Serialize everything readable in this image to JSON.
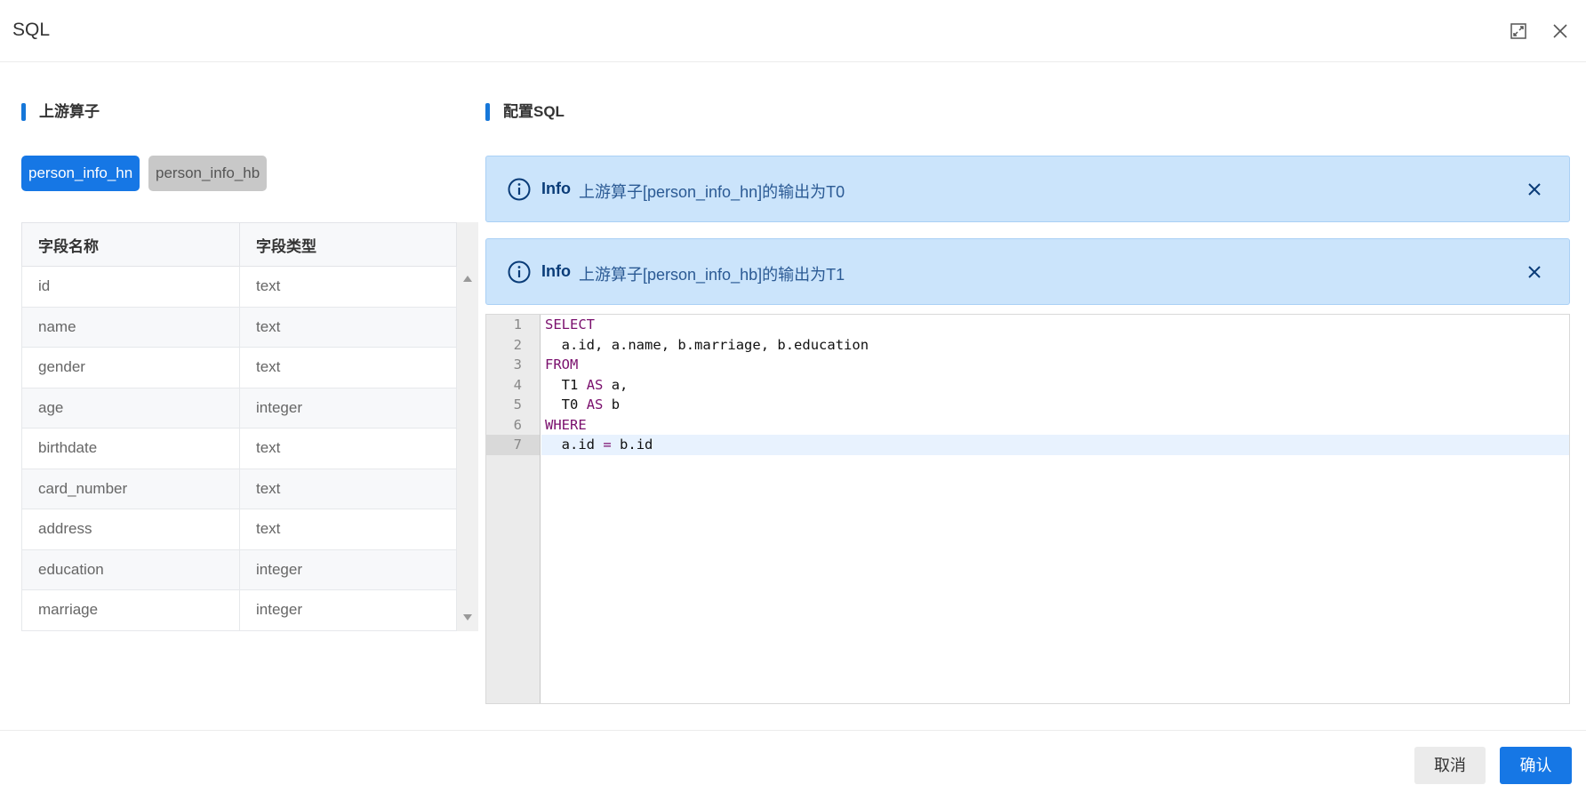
{
  "dialog": {
    "title": "SQL"
  },
  "left": {
    "section_title": "上游算子",
    "tabs": [
      {
        "label": "person_info_hn",
        "active": true
      },
      {
        "label": "person_info_hb",
        "active": false
      }
    ],
    "table": {
      "headers": [
        "字段名称",
        "字段类型"
      ],
      "rows": [
        [
          "id",
          "text"
        ],
        [
          "name",
          "text"
        ],
        [
          "gender",
          "text"
        ],
        [
          "age",
          "integer"
        ],
        [
          "birthdate",
          "text"
        ],
        [
          "card_number",
          "text"
        ],
        [
          "address",
          "text"
        ],
        [
          "education",
          "integer"
        ],
        [
          "marriage",
          "integer"
        ]
      ]
    }
  },
  "right": {
    "section_title": "配置SQL",
    "alerts": [
      {
        "label": "Info",
        "text": "上游算子[person_info_hn]的输出为T0"
      },
      {
        "label": "Info",
        "text": "上游算子[person_info_hb]的输出为T1"
      }
    ],
    "editor": {
      "lines": [
        {
          "num": "1",
          "code": "SELECT"
        },
        {
          "num": "2",
          "code": "  a.id, a.name, b.marriage, b.education"
        },
        {
          "num": "3",
          "code": "FROM"
        },
        {
          "num": "4",
          "code": "  T1 AS a,"
        },
        {
          "num": "5",
          "code": "  T0 AS b"
        },
        {
          "num": "6",
          "code": "WHERE"
        },
        {
          "num": "7",
          "code": "  a.id = b.id"
        }
      ],
      "current_line": 7
    }
  },
  "footer": {
    "cancel_label": "取消",
    "confirm_label": "确认"
  },
  "colors": {
    "accent": "#1677e5",
    "alert_bg": "#cbe4fb",
    "keyword": "#7a0f6d"
  },
  "icons": {
    "maximize": "maximize-icon",
    "close": "close-icon",
    "info": "info-icon"
  }
}
